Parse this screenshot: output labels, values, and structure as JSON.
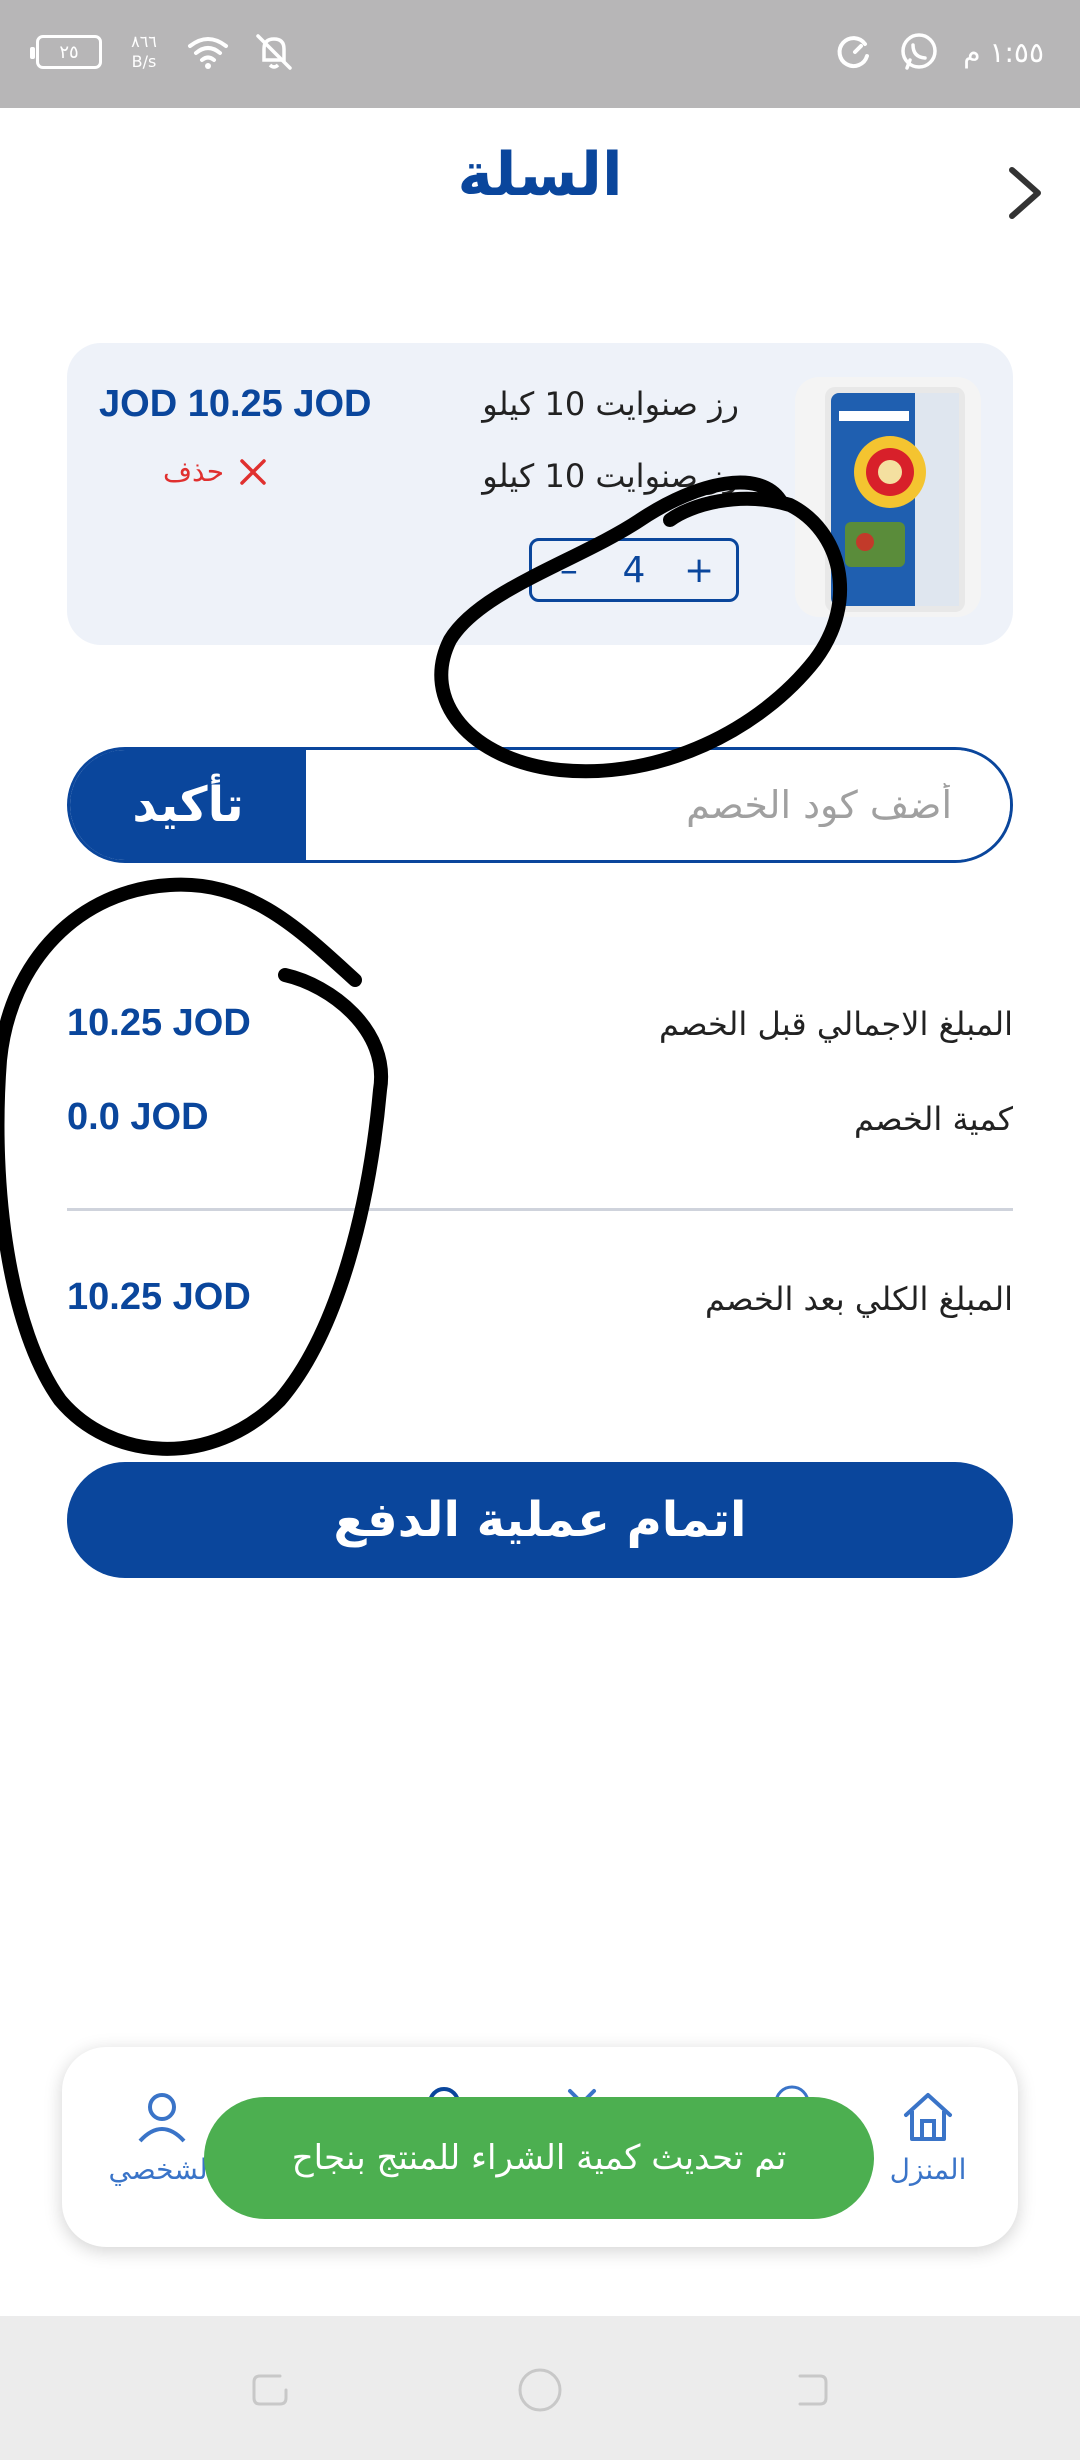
{
  "status_bar": {
    "time": "١:٥٥ م",
    "battery": "٢٥",
    "net_speed_value": "٨٦٦",
    "net_speed_unit": "B/s"
  },
  "header": {
    "title": "السلة"
  },
  "cart": {
    "items": [
      {
        "name_line1": "رز صنوايت 10 كيلو",
        "name_line2": "رز صنوايت 10 كيلو",
        "price": "JOD 10.25 JOD",
        "quantity": "4",
        "minus_label": "–",
        "plus_label": "+",
        "delete_label": "حذف"
      }
    ]
  },
  "discount": {
    "placeholder": "أضف كود الخصم",
    "confirm_label": "تأكيد"
  },
  "summary": {
    "subtotal_label": "المبلغ الاجمالي قبل الخصم",
    "subtotal_value": "10.25 JOD",
    "discount_label": "كمية الخصم",
    "discount_value": "0.0 JOD",
    "total_label": "المبلغ الكلي بعد الخصم",
    "total_value": "10.25 JOD"
  },
  "checkout": {
    "label": "اتمام عملية الدفع"
  },
  "bottom_nav": {
    "home_label": "المنزل",
    "profile_label": "الشخصي"
  },
  "toast": {
    "message": "تم تحديث كمية الشراء للمنتج بنجاح"
  },
  "colors": {
    "primary": "#0a469c",
    "delete": "#e0302f",
    "toast": "#4caf50",
    "card_bg": "#eef2f9"
  }
}
